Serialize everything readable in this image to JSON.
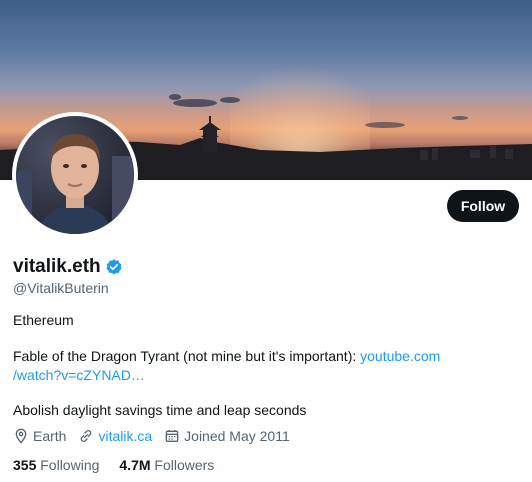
{
  "profile": {
    "display_name": "vitalik.eth",
    "handle": "@VitalikButerin",
    "follow_label": "Follow",
    "bio": {
      "line1": "Ethereum",
      "line2_text": "Fable of the Dragon Tyrant (not mine but it's important): ",
      "line2_link_a": "youtube.com",
      "line2_link_b": "/watch?v=cZYNAD…",
      "line3": "Abolish daylight savings time and leap seconds"
    },
    "location": "Earth",
    "website": "vitalik.ca",
    "joined": "Joined May 2011",
    "following_count": "355",
    "following_label": "Following",
    "followers_count": "4.7M",
    "followers_label": "Followers"
  },
  "icons": {
    "verified": "verified-badge-icon",
    "location": "location-pin-icon",
    "website": "link-icon",
    "joined": "calendar-icon"
  },
  "colors": {
    "accent": "#1d9bf0",
    "text_primary": "#0f1419",
    "text_secondary": "#536471",
    "button_bg": "#0f1419"
  }
}
